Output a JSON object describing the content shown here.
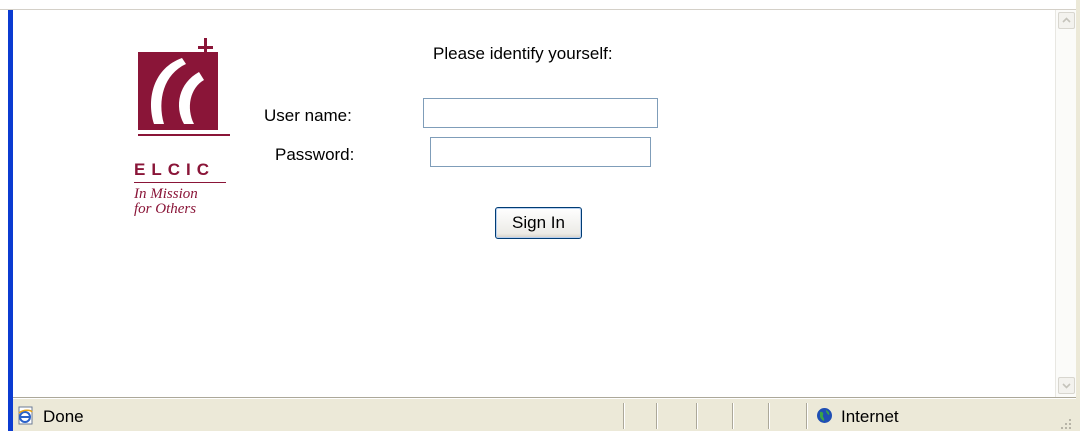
{
  "page": {
    "prompt": "Please identify yourself:"
  },
  "logo": {
    "abbrev": "ELCIC",
    "tagline": "In Mission\nfor Others",
    "brand_color": "#8a1538"
  },
  "form": {
    "username_label": "User name:",
    "username_value": "",
    "password_label": "Password:",
    "password_value": "",
    "signin_label": "Sign In"
  },
  "statusbar": {
    "status_icon": "ie-page-icon",
    "status_text": "Done",
    "zone_icon": "globe-icon",
    "zone_text": "Internet"
  },
  "colors": {
    "window_border": "#0b3bd1",
    "field_border": "#7f9db9",
    "statusbar_bg": "#ece9d8"
  }
}
